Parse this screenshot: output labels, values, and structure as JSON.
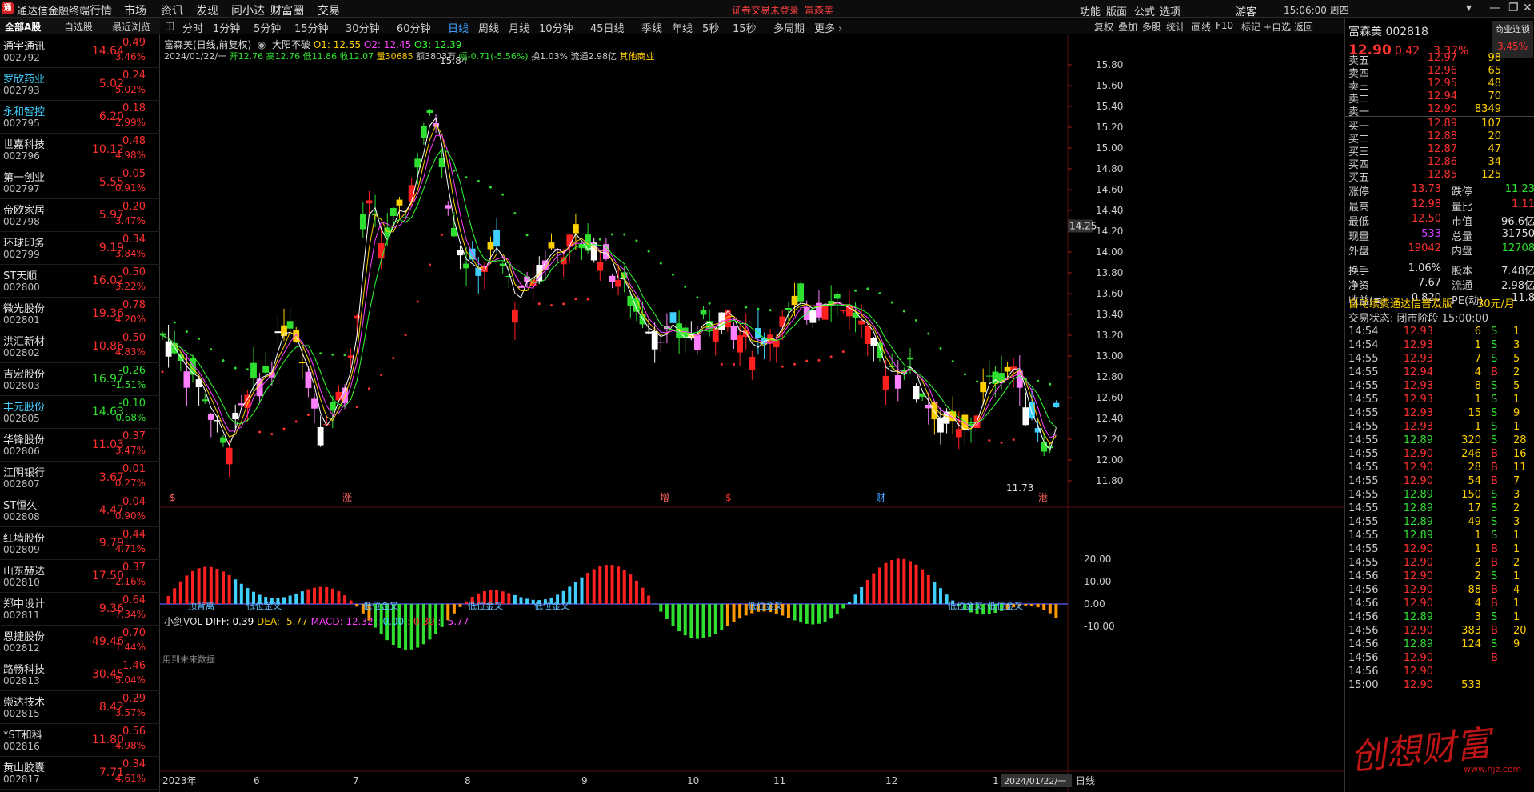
{
  "app": {
    "title": "通达信金融终端",
    "logo_text": "通",
    "menus": [
      "行情",
      "市场",
      "资讯",
      "发现",
      "问小达",
      "财富圈",
      "交易"
    ],
    "notice": "证券交易未登录",
    "notice_stock": "富森美",
    "right_menus": [
      "功能",
      "版面",
      "公式",
      "选项"
    ],
    "user": "游客",
    "clock": "15:06:00 周四",
    "win_buttons": [
      "▾",
      "—",
      "❐",
      "✕"
    ]
  },
  "sidebar": {
    "tabs": [
      "全部A股",
      "自选股",
      "最近浏览"
    ],
    "stocks": [
      {
        "name": "通宇通讯",
        "code": "002792",
        "price": "14.64",
        "chg": "0.49",
        "pct": "3.46%",
        "dir": "up",
        "hl": false
      },
      {
        "name": "罗欣药业",
        "code": "002793",
        "price": "5.02",
        "chg": "0.24",
        "pct": "5.02%",
        "dir": "up",
        "hl": true
      },
      {
        "name": "永和智控",
        "code": "002795",
        "price": "6.20",
        "chg": "0.18",
        "pct": "2.99%",
        "dir": "up",
        "hl": true
      },
      {
        "name": "世嘉科技",
        "code": "002796",
        "price": "10.12",
        "chg": "0.48",
        "pct": "4.98%",
        "dir": "up",
        "hl": false
      },
      {
        "name": "第一创业",
        "code": "002797",
        "price": "5.55",
        "chg": "0.05",
        "pct": "0.91%",
        "dir": "up",
        "hl": false
      },
      {
        "name": "帝欧家居",
        "code": "002798",
        "price": "5.97",
        "chg": "0.20",
        "pct": "3.47%",
        "dir": "up",
        "hl": false
      },
      {
        "name": "环球印务",
        "code": "002799",
        "price": "9.19",
        "chg": "0.34",
        "pct": "3.84%",
        "dir": "up",
        "hl": false
      },
      {
        "name": "ST天顺",
        "code": "002800",
        "price": "16.02",
        "chg": "0.50",
        "pct": "3.22%",
        "dir": "up",
        "hl": false
      },
      {
        "name": "微光股份",
        "code": "002801",
        "price": "19.36",
        "chg": "0.78",
        "pct": "4.20%",
        "dir": "up",
        "hl": false
      },
      {
        "name": "洪汇新材",
        "code": "002802",
        "price": "10.86",
        "chg": "0.50",
        "pct": "4.83%",
        "dir": "up",
        "hl": false
      },
      {
        "name": "吉宏股份",
        "code": "002803",
        "price": "16.97",
        "chg": "-0.26",
        "pct": "-1.51%",
        "dir": "down",
        "hl": false
      },
      {
        "name": "丰元股份",
        "code": "002805",
        "price": "14.63",
        "chg": "-0.10",
        "pct": "-0.68%",
        "dir": "down",
        "hl": true
      },
      {
        "name": "华锋股份",
        "code": "002806",
        "price": "11.03",
        "chg": "0.37",
        "pct": "3.47%",
        "dir": "up",
        "hl": false
      },
      {
        "name": "江阴银行",
        "code": "002807",
        "price": "3.67",
        "chg": "0.01",
        "pct": "0.27%",
        "dir": "up",
        "hl": false
      },
      {
        "name": "ST恒久",
        "code": "002808",
        "price": "4.47",
        "chg": "0.04",
        "pct": "0.90%",
        "dir": "up",
        "hl": false
      },
      {
        "name": "红墙股份",
        "code": "002809",
        "price": "9.79",
        "chg": "0.44",
        "pct": "4.71%",
        "dir": "up",
        "hl": false
      },
      {
        "name": "山东赫达",
        "code": "002810",
        "price": "17.50",
        "chg": "0.37",
        "pct": "2.16%",
        "dir": "up",
        "hl": false
      },
      {
        "name": "郑中设计",
        "code": "002811",
        "price": "9.36",
        "chg": "0.64",
        "pct": "7.34%",
        "dir": "up",
        "hl": false
      },
      {
        "name": "恩捷股份",
        "code": "002812",
        "price": "49.46",
        "chg": "0.70",
        "pct": "1.44%",
        "dir": "up",
        "hl": false
      },
      {
        "name": "路畅科技",
        "code": "002813",
        "price": "30.45",
        "chg": "1.46",
        "pct": "5.04%",
        "dir": "up",
        "hl": false
      },
      {
        "name": "崇达技术",
        "code": "002815",
        "price": "8.42",
        "chg": "0.29",
        "pct": "3.57%",
        "dir": "up",
        "hl": false
      },
      {
        "name": "*ST和科",
        "code": "002816",
        "price": "11.80",
        "chg": "0.56",
        "pct": "4.98%",
        "dir": "up",
        "hl": false
      },
      {
        "name": "黄山胶囊",
        "code": "002817",
        "price": "7.71",
        "chg": "0.34",
        "pct": "4.61%",
        "dir": "up",
        "hl": false
      }
    ]
  },
  "periods": [
    "分时",
    "1分钟",
    "5分钟",
    "15分钟",
    "30分钟",
    "60分钟",
    "日线",
    "周线",
    "月线",
    "10分钟",
    "45日线",
    "季线",
    "年线",
    "5秒",
    "15秒",
    "多周期",
    "更多 ›"
  ],
  "active_period": "日线",
  "tools": [
    "复权",
    "叠加",
    "多股",
    "统计",
    "画线",
    "F10",
    "标记",
    "+自选",
    "返回"
  ],
  "chart": {
    "title": "富森美(日线,前复权)",
    "indicator": "大阳不破",
    "o1": "O1: 12.55",
    "o2": "O2: 12.45",
    "o3": "O3: 12.39",
    "date": "2024/01/22/一",
    "open": "开12.76",
    "high": "高12.76",
    "low": "低11.86",
    "close": "收12.07",
    "vol": "量30685",
    "amt": "额3803万",
    "amp": "幅-0.71(-5.56%)",
    "turn": "换1.03%",
    "float": "流通2.98亿",
    "sector": "其他商业",
    "yticks": [
      "15.80",
      "15.60",
      "15.40",
      "15.20",
      "15.00",
      "14.80",
      "14.60",
      "14.40",
      "14.20",
      "14.00",
      "13.80",
      "13.60",
      "13.40",
      "13.20",
      "13.00",
      "12.80",
      "12.60",
      "12.40",
      "12.20",
      "12.00",
      "11.80"
    ],
    "cursor_price": "14.25",
    "max_label": "15.84",
    "min_label": "11.73",
    "event_marks": [
      "$",
      "涨",
      "增",
      "$",
      "财",
      "港"
    ],
    "macd": {
      "name": "小剑VOL",
      "diff": "DIFF: 0.39",
      "dea": "DEA: -5.77",
      "macd": "MACD: 12.32",
      "v1": ": 0.00",
      "v2": ": 0.39",
      "v3": ": -5.77",
      "yticks": [
        "20.00",
        "10.00",
        "0.00",
        "-10.00"
      ],
      "labels": [
        "顶背离",
        "低位金叉",
        "低位金叉",
        "低位金叉",
        "低位金叉",
        "低位金叉",
        "低位金叉",
        "低位金叉"
      ],
      "future_note": "用到未来数据"
    },
    "xlabels": [
      "2023年",
      "6",
      "7",
      "8",
      "9",
      "10",
      "11",
      "12",
      "1"
    ],
    "last_date": "2024/01/22/一",
    "period_label": "日线"
  },
  "quote": {
    "name": "富森美",
    "code": "002818",
    "price": "12.90",
    "chg": "0.42",
    "pct": "3.37%",
    "badge": "商业连锁",
    "badge_pct": "3.45%",
    "asks": [
      {
        "l": "卖五",
        "p": "12.97",
        "v": "98"
      },
      {
        "l": "卖四",
        "p": "12.96",
        "v": "65"
      },
      {
        "l": "卖三",
        "p": "12.95",
        "v": "48"
      },
      {
        "l": "卖二",
        "p": "12.94",
        "v": "70"
      },
      {
        "l": "卖一",
        "p": "12.90",
        "v": "8349"
      }
    ],
    "bids": [
      {
        "l": "买一",
        "p": "12.89",
        "v": "107"
      },
      {
        "l": "买二",
        "p": "12.88",
        "v": "20"
      },
      {
        "l": "买三",
        "p": "12.87",
        "v": "47"
      },
      {
        "l": "买四",
        "p": "12.86",
        "v": "34"
      },
      {
        "l": "买五",
        "p": "12.85",
        "v": "125"
      }
    ],
    "stats": [
      {
        "l": "涨停",
        "v": "13.73",
        "c": "#ff3030",
        "l2": "跌停",
        "v2": "11.23",
        "c2": "#30e030"
      },
      {
        "l": "最高",
        "v": "12.98",
        "c": "#ff3030",
        "l2": "量比",
        "v2": "1.11",
        "c2": "#ff3030"
      },
      {
        "l": "最低",
        "v": "12.50",
        "c": "#ff3030",
        "l2": "市值",
        "v2": "96.6亿",
        "c2": "#ddd"
      },
      {
        "l": "现量",
        "v": "533",
        "c": "#d040ff",
        "l2": "总量",
        "v2": "31750",
        "c2": "#ddd"
      },
      {
        "l": "外盘",
        "v": "19042",
        "c": "#ff3030",
        "l2": "内盘",
        "v2": "12708",
        "c2": "#30e030"
      },
      {
        "l": "换手",
        "v": "1.06%",
        "c": "#ddd",
        "l2": "股本",
        "v2": "7.48亿",
        "c2": "#ddd"
      },
      {
        "l": "净资",
        "v": "7.67",
        "c": "#ddd",
        "l2": "流通",
        "v2": "2.98亿",
        "c2": "#ddd"
      },
      {
        "l": "收益(≡)",
        "v": "0.820",
        "c": "#ddd",
        "l2": "PE(动)",
        "v2": "11.8",
        "c2": "#ddd"
      }
    ],
    "promo": "自动续费通达信普及版",
    "promo_price": "30元/月",
    "status": "交易状态: 闭市阶段 15:00:00",
    "ticks": [
      [
        "14:54",
        "12.93",
        "6",
        "S"
      ],
      [
        "14:54",
        "12.93",
        "1",
        "S"
      ],
      [
        "14:55",
        "12.93",
        "7",
        "S"
      ],
      [
        "14:55",
        "12.94",
        "4",
        "B"
      ],
      [
        "14:55",
        "12.93",
        "8",
        "S"
      ],
      [
        "14:55",
        "12.93",
        "1",
        "S"
      ],
      [
        "14:55",
        "12.93",
        "15",
        "S"
      ],
      [
        "14:55",
        "12.93",
        "1",
        "S"
      ],
      [
        "14:55",
        "12.89",
        "320",
        "S"
      ],
      [
        "14:55",
        "12.90",
        "246",
        "B"
      ],
      [
        "14:55",
        "12.90",
        "28",
        "B"
      ],
      [
        "14:55",
        "12.90",
        "54",
        "B"
      ],
      [
        "14:55",
        "12.89",
        "150",
        "S"
      ],
      [
        "14:55",
        "12.89",
        "17",
        "S"
      ],
      [
        "14:55",
        "12.89",
        "49",
        "S"
      ],
      [
        "14:55",
        "12.89",
        "1",
        "S"
      ],
      [
        "14:55",
        "12.90",
        "1",
        "B"
      ],
      [
        "14:55",
        "12.90",
        "2",
        "B"
      ],
      [
        "14:56",
        "12.90",
        "2",
        "S"
      ],
      [
        "14:56",
        "12.90",
        "88",
        "B"
      ],
      [
        "14:56",
        "12.90",
        "4",
        "B"
      ],
      [
        "14:56",
        "12.89",
        "3",
        "S"
      ],
      [
        "14:56",
        "12.90",
        "383",
        "B"
      ],
      [
        "14:56",
        "12.89",
        "124",
        "S"
      ],
      [
        "14:56",
        "12.90",
        "",
        "B"
      ],
      [
        "14:56",
        "12.90",
        "",
        ""
      ],
      [
        "15:00",
        "12.90",
        "533",
        ""
      ]
    ],
    "tick_extra": [
      "1",
      "3",
      "5",
      "2",
      "5",
      "1",
      "9",
      "1",
      "28",
      "16",
      "11",
      "7",
      "3",
      "2",
      "3",
      "1",
      "1",
      "2",
      "1",
      "4",
      "1",
      "1",
      "20",
      "9",
      "",
      "",
      ""
    ]
  },
  "watermark": "创想财富",
  "watermark_site": "www.hjz.com"
}
